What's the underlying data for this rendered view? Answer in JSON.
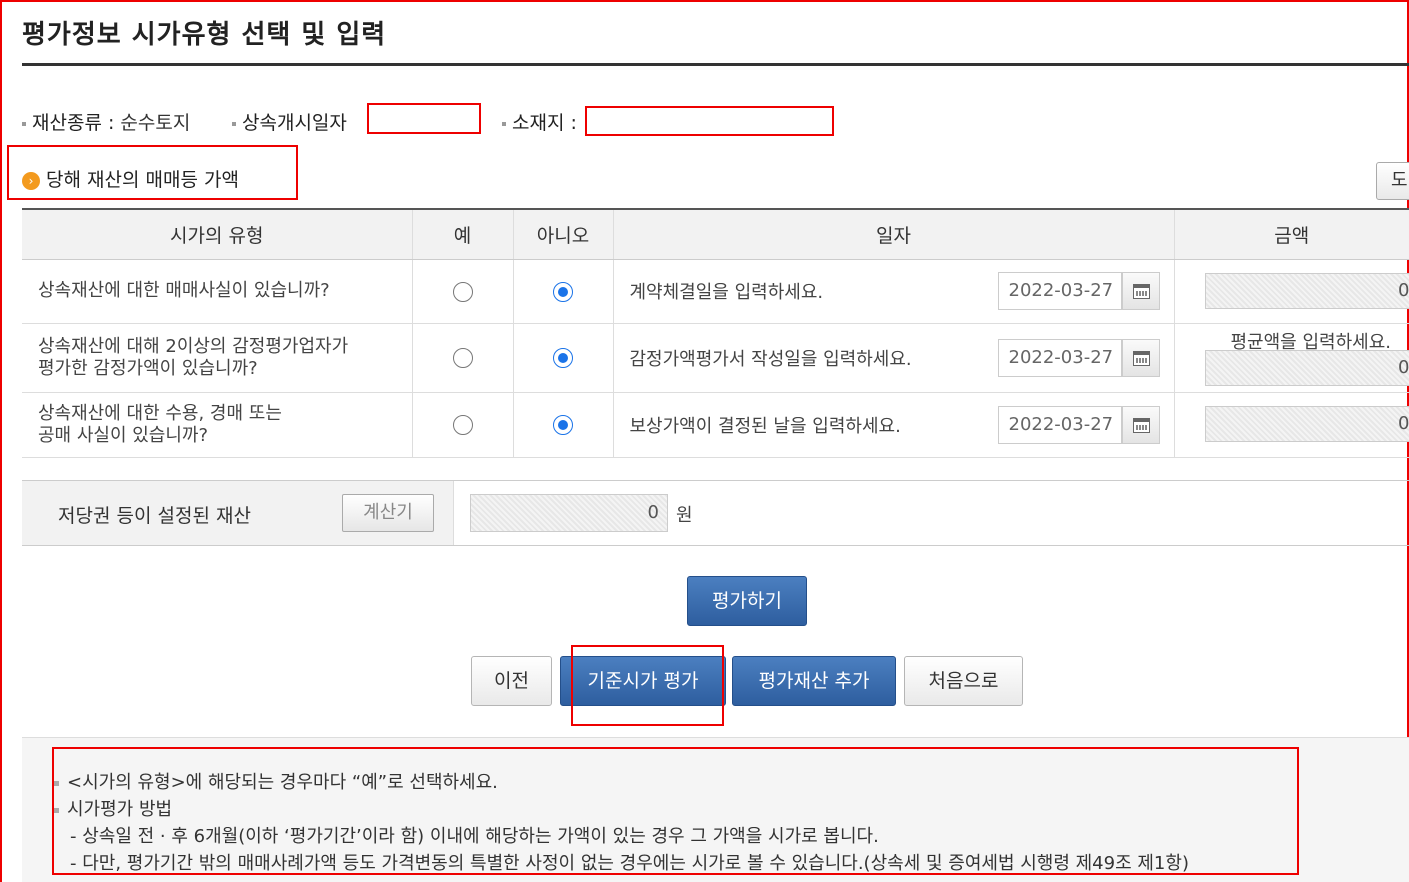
{
  "page": {
    "title": "평가정보 시가유형 선택 및 입력"
  },
  "info": {
    "property_type_label": "재산종류 :",
    "property_type_value": "순수토지",
    "inheritance_date_label": "상속개시일자",
    "location_label": "소재지 :"
  },
  "section": {
    "title": "당해 재산의 매매등 가액",
    "partial_button": "도"
  },
  "table": {
    "headers": [
      "시가의 유형",
      "예",
      "아니오",
      "일자",
      "금액"
    ],
    "rows": [
      {
        "question_line1": "상속재산에 대한 매매사실이 있습니까?",
        "question_line2": "",
        "yes_selected": false,
        "no_selected": true,
        "date_desc": "계약체결일을 입력하세요.",
        "date_value": "2022-03-27",
        "amount_note": "",
        "amount_value": "0"
      },
      {
        "question_line1": "상속재산에 대해 2이상의 감정평가업자가",
        "question_line2": "평가한 감정가액이 있습니까?",
        "yes_selected": false,
        "no_selected": true,
        "date_desc": "감정가액평가서 작성일을 입력하세요.",
        "date_value": "2022-03-27",
        "amount_note": "평균액을 입력하세요.",
        "amount_value": "0"
      },
      {
        "question_line1": "상속재산에 대한 수용, 경매 또는",
        "question_line2": "공매 사실이 있습니까?",
        "yes_selected": false,
        "no_selected": true,
        "date_desc": "보상가액이 결정된 날을 입력하세요.",
        "date_value": "2022-03-27",
        "amount_note": "",
        "amount_value": "0"
      }
    ]
  },
  "mortgage": {
    "label": "저당권 등이 설정된 재산",
    "calc_button": "계산기",
    "value": "0",
    "unit": "원"
  },
  "buttons": {
    "evaluate": "평가하기",
    "prev": "이전",
    "standard_eval": "기준시가 평가",
    "add_property": "평가재산 추가",
    "home": "처음으로"
  },
  "notes": {
    "line1": "<시가의 유형>에 해당되는 경우마다 “예”로 선택하세요.",
    "line2": "시가평가 방법",
    "line3": "- 상속일 전 · 후 6개월(이하 ‘평가기간’이라 함) 이내에 해당하는 가액이 있는 경우 그 가액을 시가로 봅니다.",
    "line4": "- 다만, 평가기간 밖의 매매사례가액 등도 가격변동의 특별한 사정이 없는 경우에는 시가로 볼 수 있습니다.(상속세 및 증여세법 시행령 제49조 제1항)"
  },
  "colors": {
    "highlight": "#ee0000",
    "primary_button": "#2e5e9f",
    "radio_selected": "#1a73e8",
    "section_icon": "#f39a1e"
  }
}
